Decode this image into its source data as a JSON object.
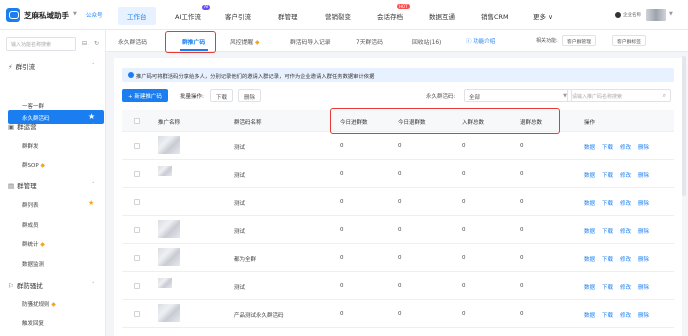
{
  "header": {
    "app_title": "芝麻私域助手",
    "app_sub": "公众号",
    "nav": [
      "工作台",
      "AI工作流",
      "客户引流",
      "群管理",
      "营销裂变",
      "会话存档",
      "数据互通",
      "销售CRM",
      "更多"
    ],
    "badge_ai": "AI",
    "badge_hot": "HOT",
    "more_caret": "∨",
    "user_name": "企业名称"
  },
  "sidebar": {
    "search_placeholder": "输入功能名称搜索",
    "groups": [
      {
        "icon": "⚡",
        "label": "群引流",
        "items": [
          "永久群活码",
          "一客一群"
        ]
      },
      {
        "icon": "▣",
        "label": "群运营",
        "items": [
          "群群发",
          "群SOP"
        ]
      },
      {
        "icon": "▤",
        "label": "群管理",
        "items": [
          "群列表",
          "群成员",
          "群统计",
          "数据监测"
        ]
      },
      {
        "icon": "⚐",
        "label": "群防骚扰",
        "items": [
          "防骚扰规则",
          "触发回复"
        ]
      }
    ]
  },
  "tabs": {
    "items": [
      "永久群活码",
      "群推广码",
      "风控提醒",
      "群活码导入记录",
      "7天群活码",
      "回收站(16)"
    ],
    "active_index": 1,
    "help": "功能介绍",
    "related_label": "相关功能:",
    "related": [
      "客户群管理",
      "客户群标签"
    ]
  },
  "toolbar": {
    "notice": "推广码可将群活码分享给多人，分别记录他们的邀请入群记录，可作为企业邀请入群任务数据审计依据",
    "new_button": "+ 新建推广码",
    "batch_label": "批量操作:",
    "download": "下载",
    "delete": "删除",
    "filter_label": "永久群活码:",
    "filter_value": "全部",
    "search_placeholder": "请输入推广码名称搜索"
  },
  "table": {
    "columns": [
      "推广名称",
      "群活码名称",
      "今日进群数",
      "今日退群数",
      "入群总数",
      "退群总数",
      "操作"
    ],
    "rows": [
      {
        "code": "测试",
        "vals": [
          "0",
          "0",
          "0",
          "0"
        ]
      },
      {
        "code": "测试",
        "vals": [
          "0",
          "0",
          "0",
          "0"
        ]
      },
      {
        "code": "测试",
        "vals": [
          "0",
          "0",
          "0",
          "0"
        ]
      },
      {
        "code": "测试",
        "vals": [
          "0",
          "0",
          "0",
          "0"
        ]
      },
      {
        "code": "都为全群",
        "vals": [
          "0",
          "0",
          "0",
          "0"
        ]
      },
      {
        "code": "测试",
        "vals": [
          "0",
          "0",
          "0",
          "0"
        ]
      },
      {
        "code": "产品测试永久群活码",
        "vals": [
          "0",
          "0",
          "0",
          "0"
        ]
      }
    ],
    "ops": [
      "数据",
      "下载",
      "修改",
      "删除"
    ]
  },
  "colors": {
    "primary": "#1b7ef0",
    "highlight_box": "#e53935",
    "accent": "#f5a623"
  }
}
